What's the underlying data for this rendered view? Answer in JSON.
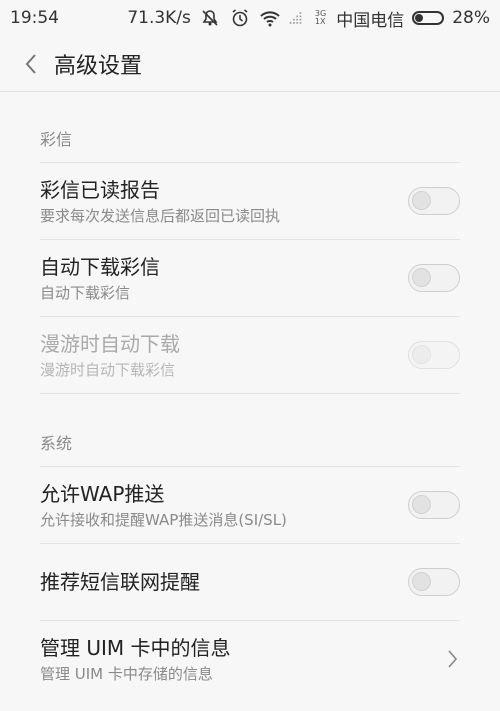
{
  "status_bar": {
    "time": "19:54",
    "net_speed": "71.3K/s",
    "net_type_top": "3G",
    "net_type_bottom": "1X",
    "carrier": "中国电信",
    "battery": "28%",
    "battery_level": 0.28
  },
  "header": {
    "title": "高级设置",
    "back_icon": "chevron-left-icon"
  },
  "sections": {
    "mms": {
      "header": "彩信",
      "items": [
        {
          "title": "彩信已读报告",
          "subtitle": "要求每次发送信息后都返回已读回执",
          "toggle": false,
          "enabled": true
        },
        {
          "title": "自动下载彩信",
          "subtitle": "自动下载彩信",
          "toggle": false,
          "enabled": true
        },
        {
          "title": "漫游时自动下载",
          "subtitle": "漫游时自动下载彩信",
          "toggle": false,
          "enabled": false
        }
      ]
    },
    "system": {
      "header": "系统",
      "items": [
        {
          "title": "允许WAP推送",
          "subtitle": "允许接收和提醒WAP推送消息(SI/SL)",
          "toggle": false
        },
        {
          "title": "推荐短信联网提醒",
          "toggle": false
        },
        {
          "title": "管理 UIM 卡中的信息",
          "subtitle": "管理 UIM 卡中存储的信息"
        }
      ]
    }
  }
}
